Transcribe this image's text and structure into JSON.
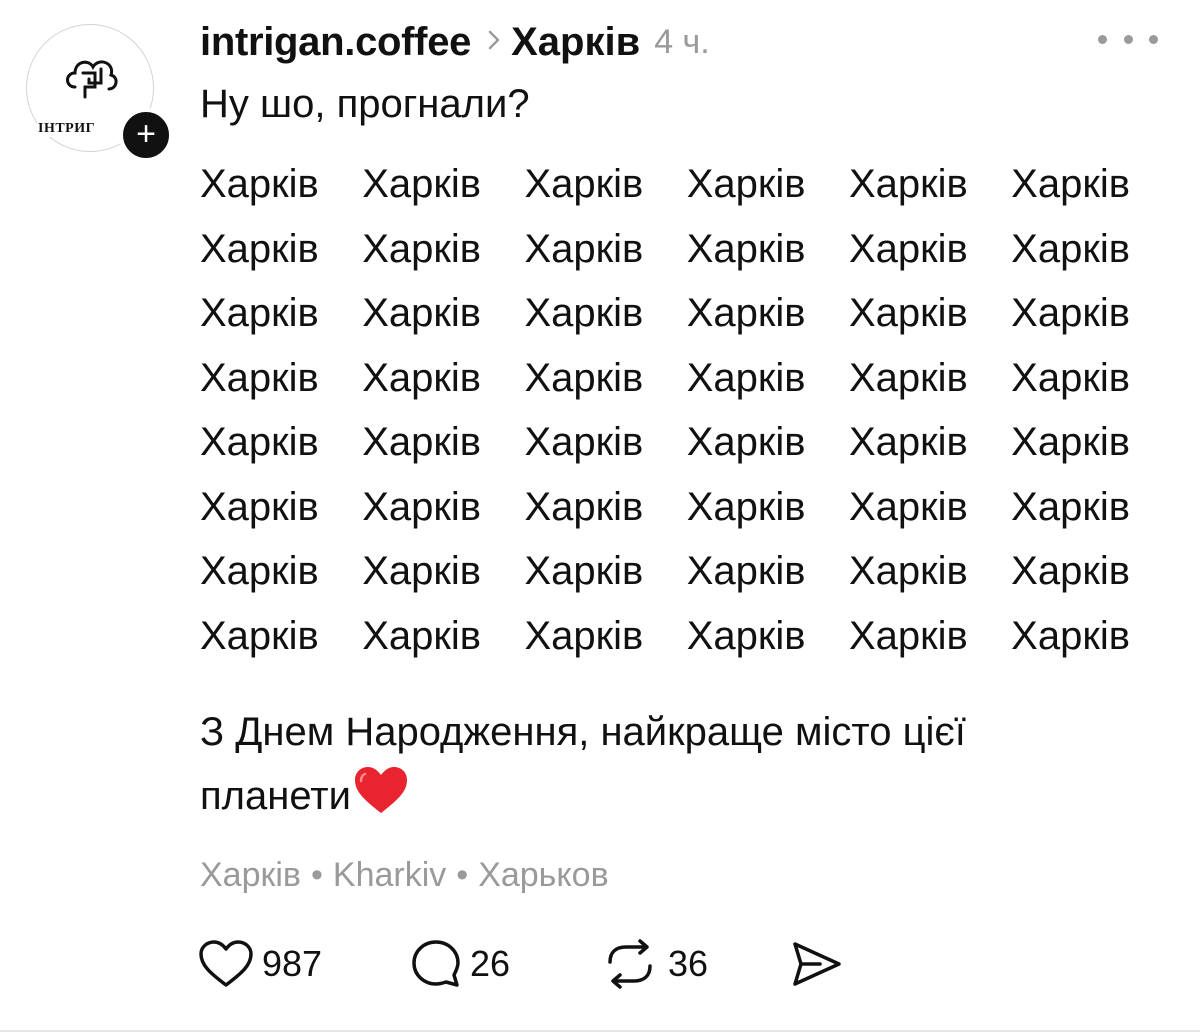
{
  "post": {
    "username": "intrigan.coffee",
    "location": "Харків",
    "time": "4 ч.",
    "avatar_text": "ІНТРИГ",
    "intro": "Ну шо, прогнали?",
    "city_rows": [
      [
        "Харків",
        "Харків",
        "Харків",
        "Харків",
        "Харків",
        "Харків"
      ],
      [
        "Харків",
        "Харків",
        "Харків",
        "Харків",
        "Харків",
        "Харків"
      ],
      [
        "Харків",
        "Харків",
        "Харків",
        "Харків",
        "Харків",
        "Харків"
      ],
      [
        "Харків",
        "Харків",
        "Харків",
        "Харків",
        "Харків",
        "Харків"
      ],
      [
        "Харків",
        "Харків",
        "Харків",
        "Харків",
        "Харків",
        "Харків"
      ],
      [
        "Харків",
        "Харків",
        "Харків",
        "Харків",
        "Харків",
        "Харків"
      ],
      [
        "Харків",
        "Харків",
        "Харків",
        "Харків",
        "Харків",
        "Харків"
      ],
      [
        "Харків",
        "Харків",
        "Харків",
        "Харків",
        "Харків",
        "Харків"
      ]
    ],
    "birthday_line1": "З Днем Народження, найкраще місто цієї",
    "birthday_line2": "планети",
    "tags": [
      "Харків",
      "Kharkiv",
      "Харьков"
    ],
    "tag_separator": "•",
    "likes": "987",
    "comments": "26",
    "reposts": "36"
  },
  "icons": {
    "avatar_logo": "cloud-logo-icon",
    "follow": "plus-icon",
    "more": "more-dots-icon",
    "location_arrow": "chevron-right-icon",
    "like": "heart-outline-icon",
    "comment": "speech-bubble-icon",
    "repost": "repost-arrows-icon",
    "share": "send-icon",
    "emoji": "red-heart-emoji"
  },
  "colors": {
    "text": "#111111",
    "muted": "#9a9a9a",
    "heart": "#e8242f"
  }
}
